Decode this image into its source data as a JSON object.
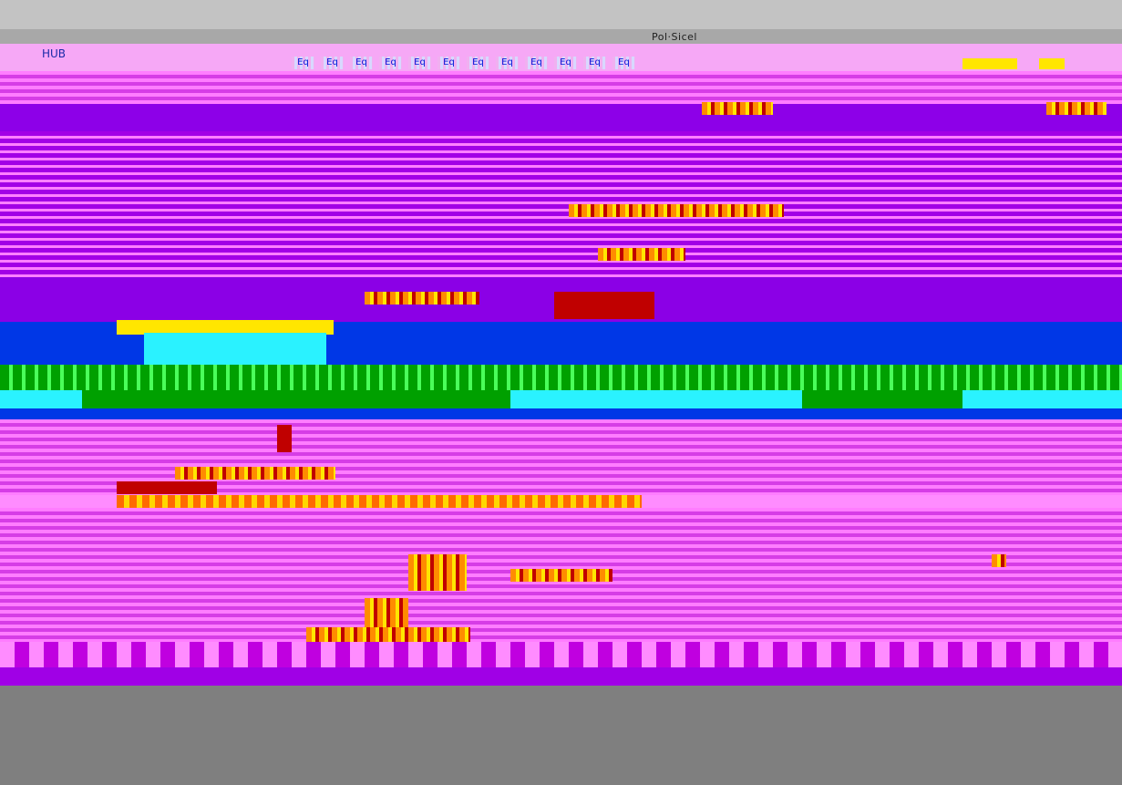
{
  "window": {
    "title": "Pol·Sicel"
  },
  "menubar": {
    "app_label": "HUB",
    "items": [
      "Eq",
      "Eq",
      "Eq",
      "Eq",
      "Eq",
      "Eq",
      "Eq",
      "Eq",
      "Eq",
      "Eq",
      "Eq",
      "Eq"
    ]
  },
  "colors": {
    "background": "#7f7f7f",
    "app": "#8b00e6",
    "menubar": "#f6a8f6",
    "accent_blue": "#0037e6",
    "accent_cyan": "#2af2ff",
    "accent_green": "#00a000",
    "accent_yellow": "#ffe600"
  }
}
